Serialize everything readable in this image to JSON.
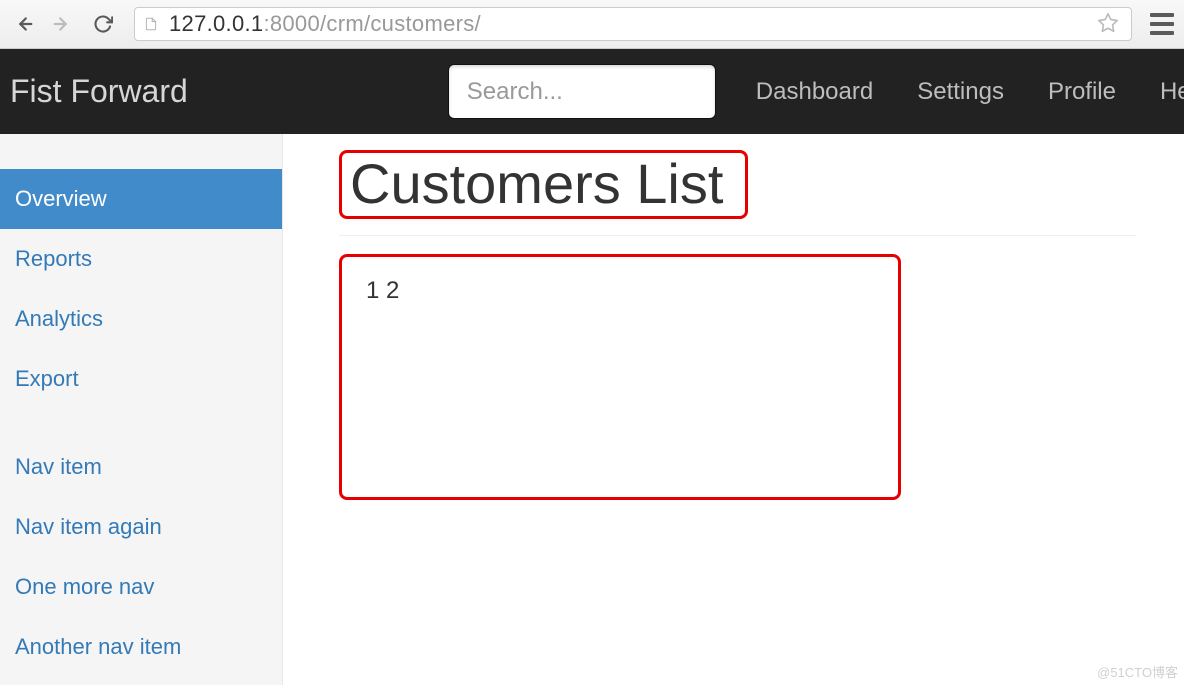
{
  "browser": {
    "url_host": "127.0.0.1",
    "url_path": ":8000/crm/customers/"
  },
  "navbar": {
    "brand": "Fist Forward",
    "search_placeholder": "Search...",
    "links": {
      "dashboard": "Dashboard",
      "settings": "Settings",
      "profile": "Profile",
      "help": "Help"
    }
  },
  "sidebar": {
    "group1": {
      "overview": "Overview",
      "reports": "Reports",
      "analytics": "Analytics",
      "export": "Export"
    },
    "group2": {
      "nav_item": "Nav item",
      "nav_item_again": "Nav item again",
      "one_more_nav": "One more nav",
      "another_nav_item": "Another nav item"
    }
  },
  "main": {
    "title": "Customers List",
    "content": "1 2"
  },
  "watermark": "@51CTO博客"
}
